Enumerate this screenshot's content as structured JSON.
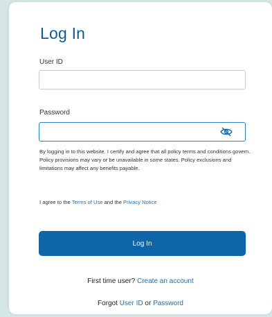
{
  "login": {
    "title": "Log In",
    "user_id_label": "User ID",
    "user_id_value": "",
    "password_label": "Password",
    "password_value": "",
    "disclaimer": "By logging in to this website, I certify and agree that all policy terms and conditions govern. Policy provisions may vary or be unavailable in some states. Policy exclusions and limitations may affect any benefits payable.",
    "agree_prefix": "I agree to the ",
    "terms_link": "Terms of Use",
    "agree_middle": " and the ",
    "privacy_link": "Privacy Notice",
    "login_button": "Log In",
    "first_time_prefix": "First time user? ",
    "create_account_link": "Create an account",
    "forgot_prefix": "Forgot ",
    "forgot_user_id_link": "User ID",
    "forgot_or": " or ",
    "forgot_password_link": "Password"
  },
  "icons": {
    "password_toggle": "eye-slash-icon"
  },
  "colors": {
    "background": "#d3e6e4",
    "title": "#0e5b9a",
    "link": "#1a6fb5",
    "button": "#0e65a8",
    "focus_border": "#2a83c7"
  }
}
